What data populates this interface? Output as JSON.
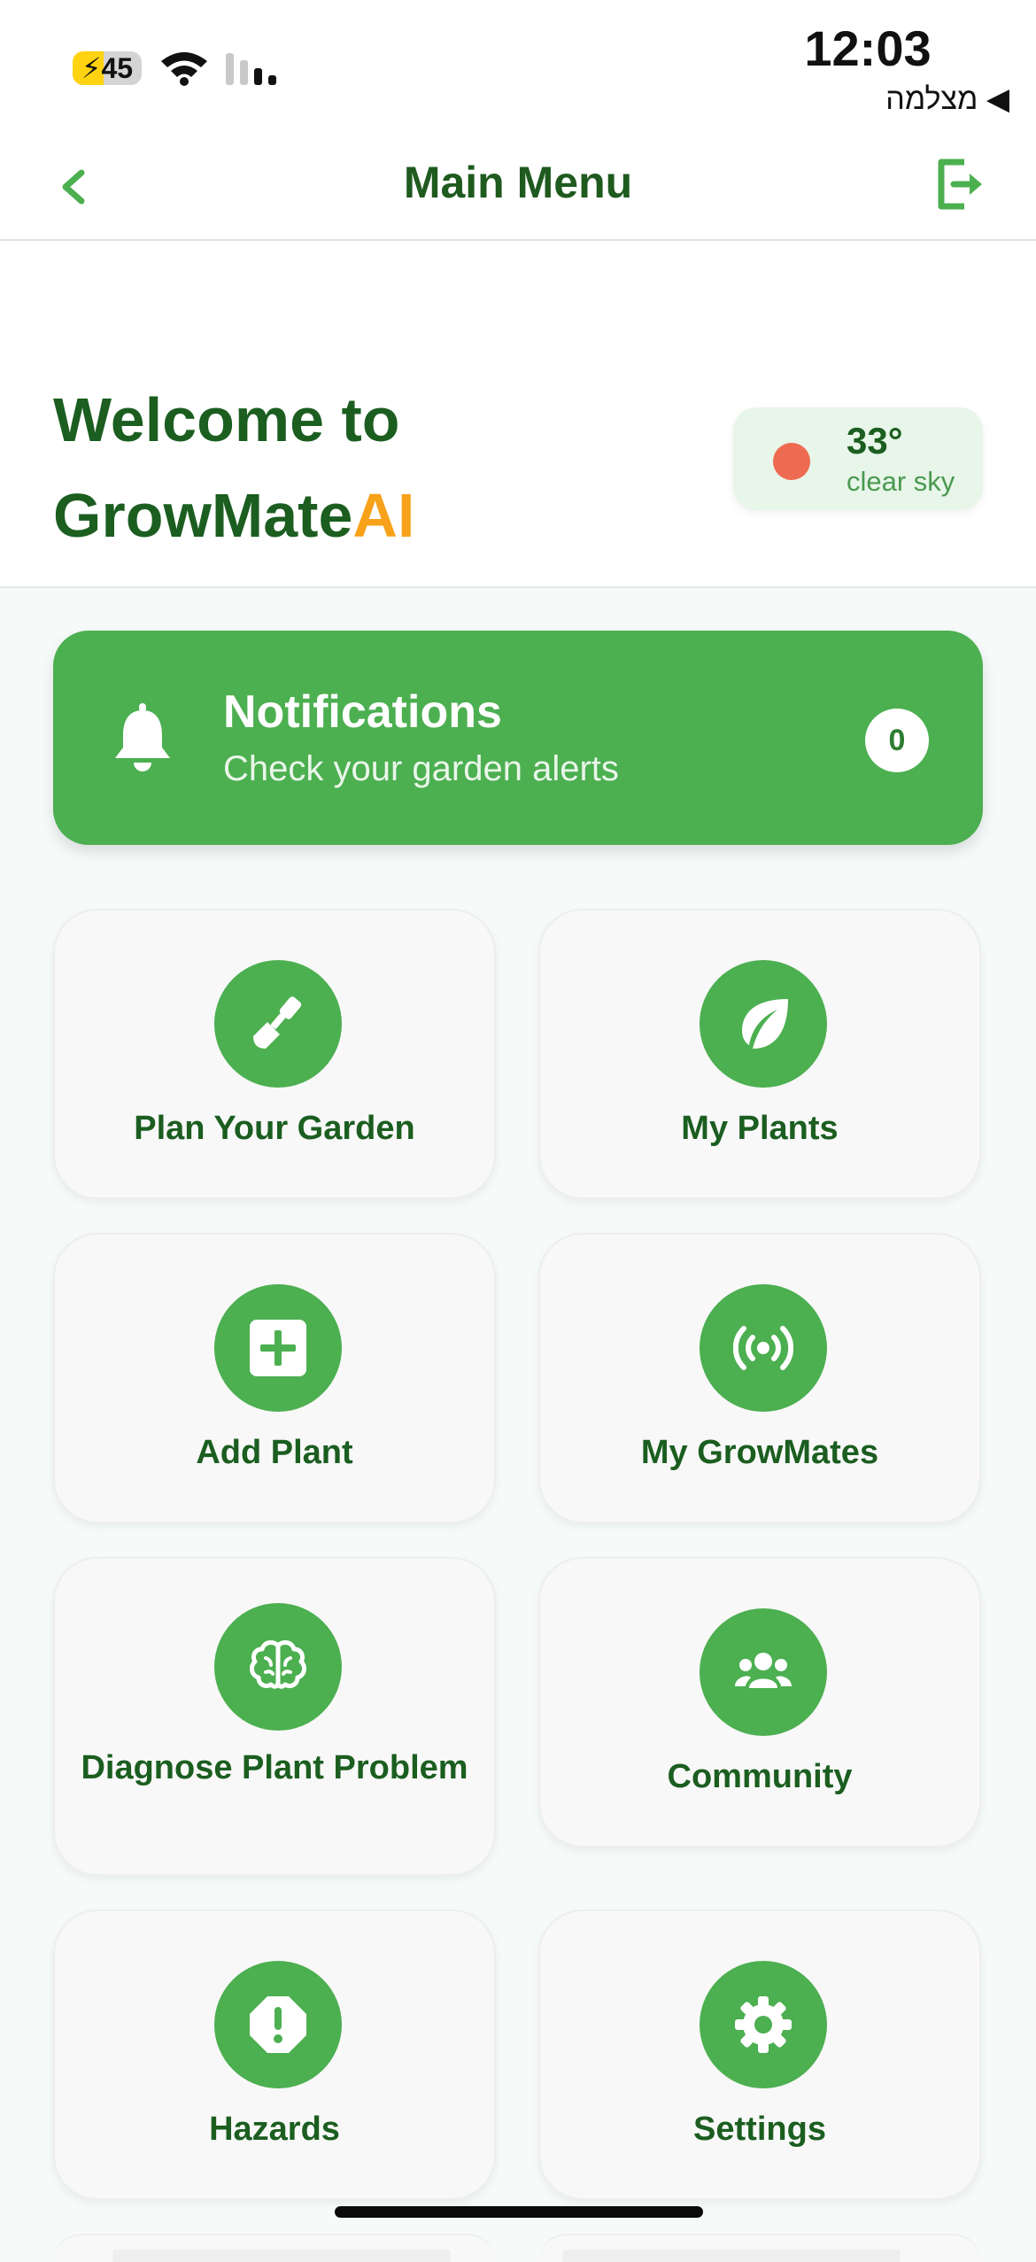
{
  "status_bar": {
    "battery_level": "45",
    "battery_percent": 45,
    "time": "12:03",
    "back_app": "◀ מצלמה"
  },
  "nav": {
    "title": "Main Menu",
    "back_icon": "chevron-left-icon",
    "logout_icon": "logout-icon"
  },
  "welcome": {
    "line1": "Welcome to",
    "brand": "GrowMate",
    "brand_accent": "AI"
  },
  "weather": {
    "temperature": "33°",
    "description": "clear sky"
  },
  "notifications": {
    "title": "Notifications",
    "subtitle": "Check your garden alerts",
    "count": "0"
  },
  "menu": {
    "items": [
      {
        "label": "Plan Your Garden",
        "icon": "trowel-icon"
      },
      {
        "label": "My Plants",
        "icon": "leaf-icon"
      },
      {
        "label": "Add Plant",
        "icon": "plus-square-icon"
      },
      {
        "label": "My GrowMates",
        "icon": "broadcast-icon"
      },
      {
        "label": "Diagnose Plant Problem",
        "icon": "brain-icon"
      },
      {
        "label": "Community",
        "icon": "users-icon"
      },
      {
        "label": "Hazards",
        "icon": "alert-octagon-icon"
      },
      {
        "label": "Settings",
        "icon": "gear-icon"
      }
    ]
  },
  "colors": {
    "primary": "#4caf50",
    "dark_green": "#1b5e20",
    "accent_orange": "#f7a21a",
    "weather_dot": "#ee6a50"
  }
}
